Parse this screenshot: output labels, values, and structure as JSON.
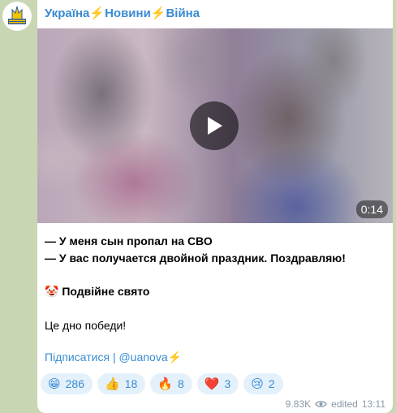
{
  "channel": {
    "title": "Україна⚡️Новини⚡️Війна",
    "avatar_text": "УКРАЇНА НОВИНИ"
  },
  "video": {
    "duration": "0:14"
  },
  "post": {
    "line1": "— У меня сын пропал на СВО",
    "line2": "— У вас получается двойной праздник. Поздравляю!",
    "line3": "🤡 Подвійне свято",
    "line4": "Це дно победи!",
    "subscribe_label": "Підписатися",
    "separator": "|",
    "handle": "@uanova⚡️"
  },
  "reactions": [
    {
      "emoji": "😁",
      "count": "286",
      "icon": "grin-icon"
    },
    {
      "emoji": "👍",
      "count": "18",
      "icon": "thumbs-up-icon"
    },
    {
      "emoji": "🔥",
      "count": "8",
      "icon": "fire-icon"
    },
    {
      "emoji": "❤️",
      "count": "3",
      "icon": "heart-icon"
    },
    {
      "emoji": "😢",
      "count": "2",
      "icon": "crying-icon"
    }
  ],
  "meta": {
    "views": "9.83K",
    "edited": "edited",
    "time": "13:11"
  },
  "colors": {
    "accent": "#3a8bd1",
    "reaction_bg": "#e4f1fb",
    "chat_bg": "#c8d6b4"
  }
}
